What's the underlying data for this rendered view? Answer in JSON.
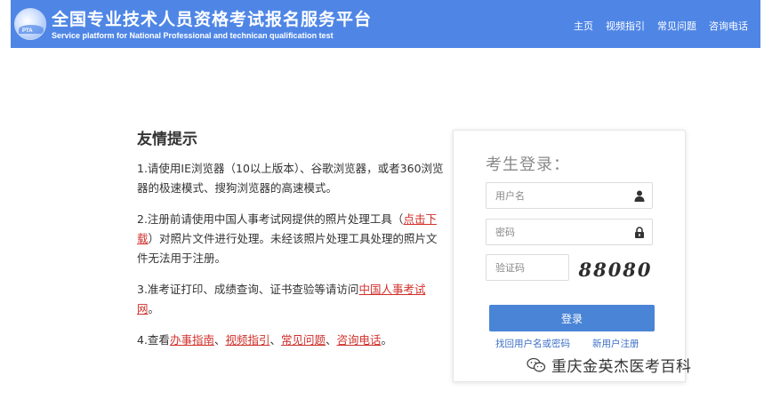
{
  "header": {
    "logo_text": "PTA",
    "title_cn": "全国专业技术人员资格考试报名服务平台",
    "title_en": "Service platform for National Professional and technican qualification test",
    "nav": [
      "主页",
      "视频指引",
      "常见问题",
      "咨询电话"
    ]
  },
  "tips": {
    "title": "友情提示",
    "tip1": "1.请使用IE浏览器（10以上版本）、谷歌浏览器，或者360浏览器的极速模式、搜狗浏览器的高速模式。",
    "tip2_before": "2.注册前请使用中国人事考试网提供的照片处理工具（",
    "tip2_link": "点击下载",
    "tip2_after": "）对照片文件进行处理。未经该照片处理工具处理的照片文件无法用于注册。",
    "tip3_before": "3.准考证打印、成绩查询、证书查验等请访问",
    "tip3_link": "中国人事考试网",
    "tip3_after": "。",
    "tip4_before": "4.查看",
    "tip4_link1": "办事指南",
    "tip4_sep1": "、",
    "tip4_link2": "视频指引",
    "tip4_sep2": "、",
    "tip4_link3": "常见问题",
    "tip4_sep3": "、",
    "tip4_link4": "咨询电话",
    "tip4_after": "。"
  },
  "login": {
    "title": "考生登录：",
    "username_placeholder": "用户名",
    "password_placeholder": "密码",
    "captcha_placeholder": "验证码",
    "captcha_value": "88080",
    "submit_label": "登录",
    "forgot_link": "找回用户名或密码",
    "register_link": "新用户注册"
  },
  "watermark": {
    "text": "重庆金英杰医考百科"
  },
  "colors": {
    "header_bg": "#4f86e6",
    "button_bg": "#4a84d6",
    "link_red": "#d0302b",
    "link_blue": "#3d6fc7"
  }
}
